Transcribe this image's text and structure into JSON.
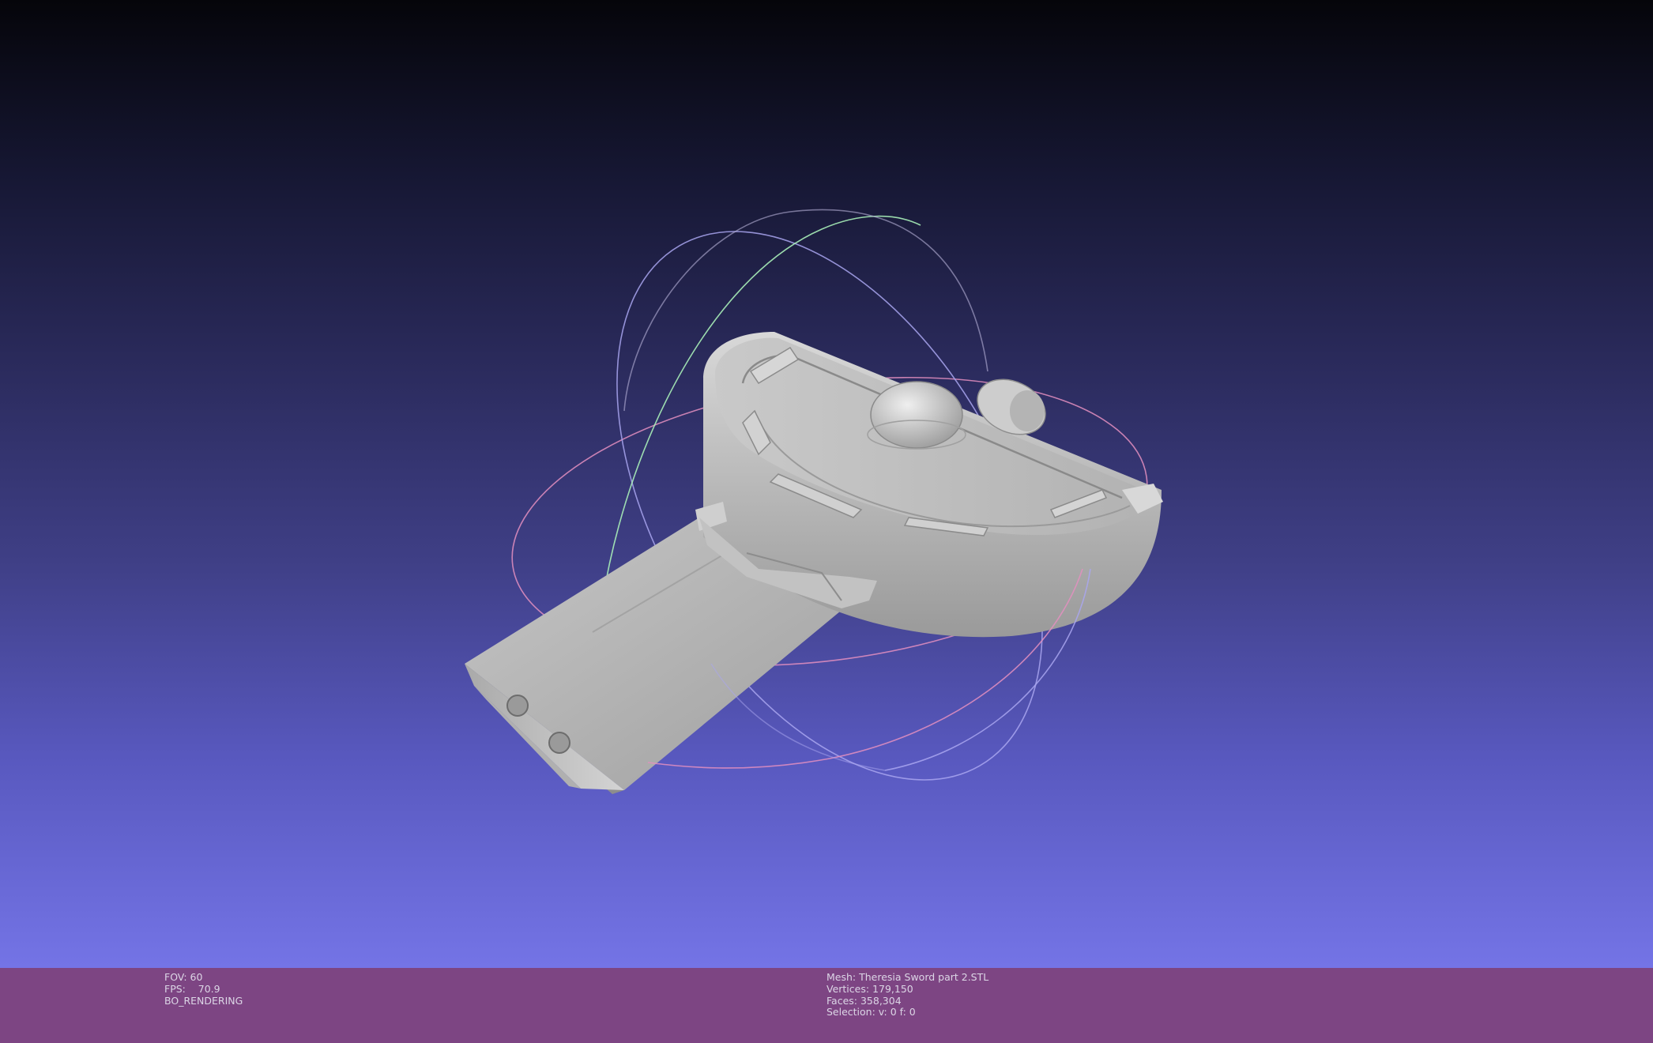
{
  "viewport": {
    "background_top": "#05050a",
    "background_bottom": "#7474e6",
    "trackball_colors": {
      "x_ring": "#e48fbf",
      "y_ring": "#a8f0b8",
      "z_ring": "#a9a6f0"
    },
    "mesh_color": "#bdbdbd"
  },
  "statusbar": {
    "background": "#7d4583",
    "render_info": {
      "fov": "FOV: 60",
      "fps": "FPS:    70.9",
      "mode": "BO_RENDERING"
    },
    "mesh_info": {
      "mesh": "Mesh: Theresia Sword part 2.STL",
      "vertices": "Vertices: 179,150",
      "faces": "Faces: 358,304",
      "selection": "Selection: v: 0 f: 0"
    }
  }
}
